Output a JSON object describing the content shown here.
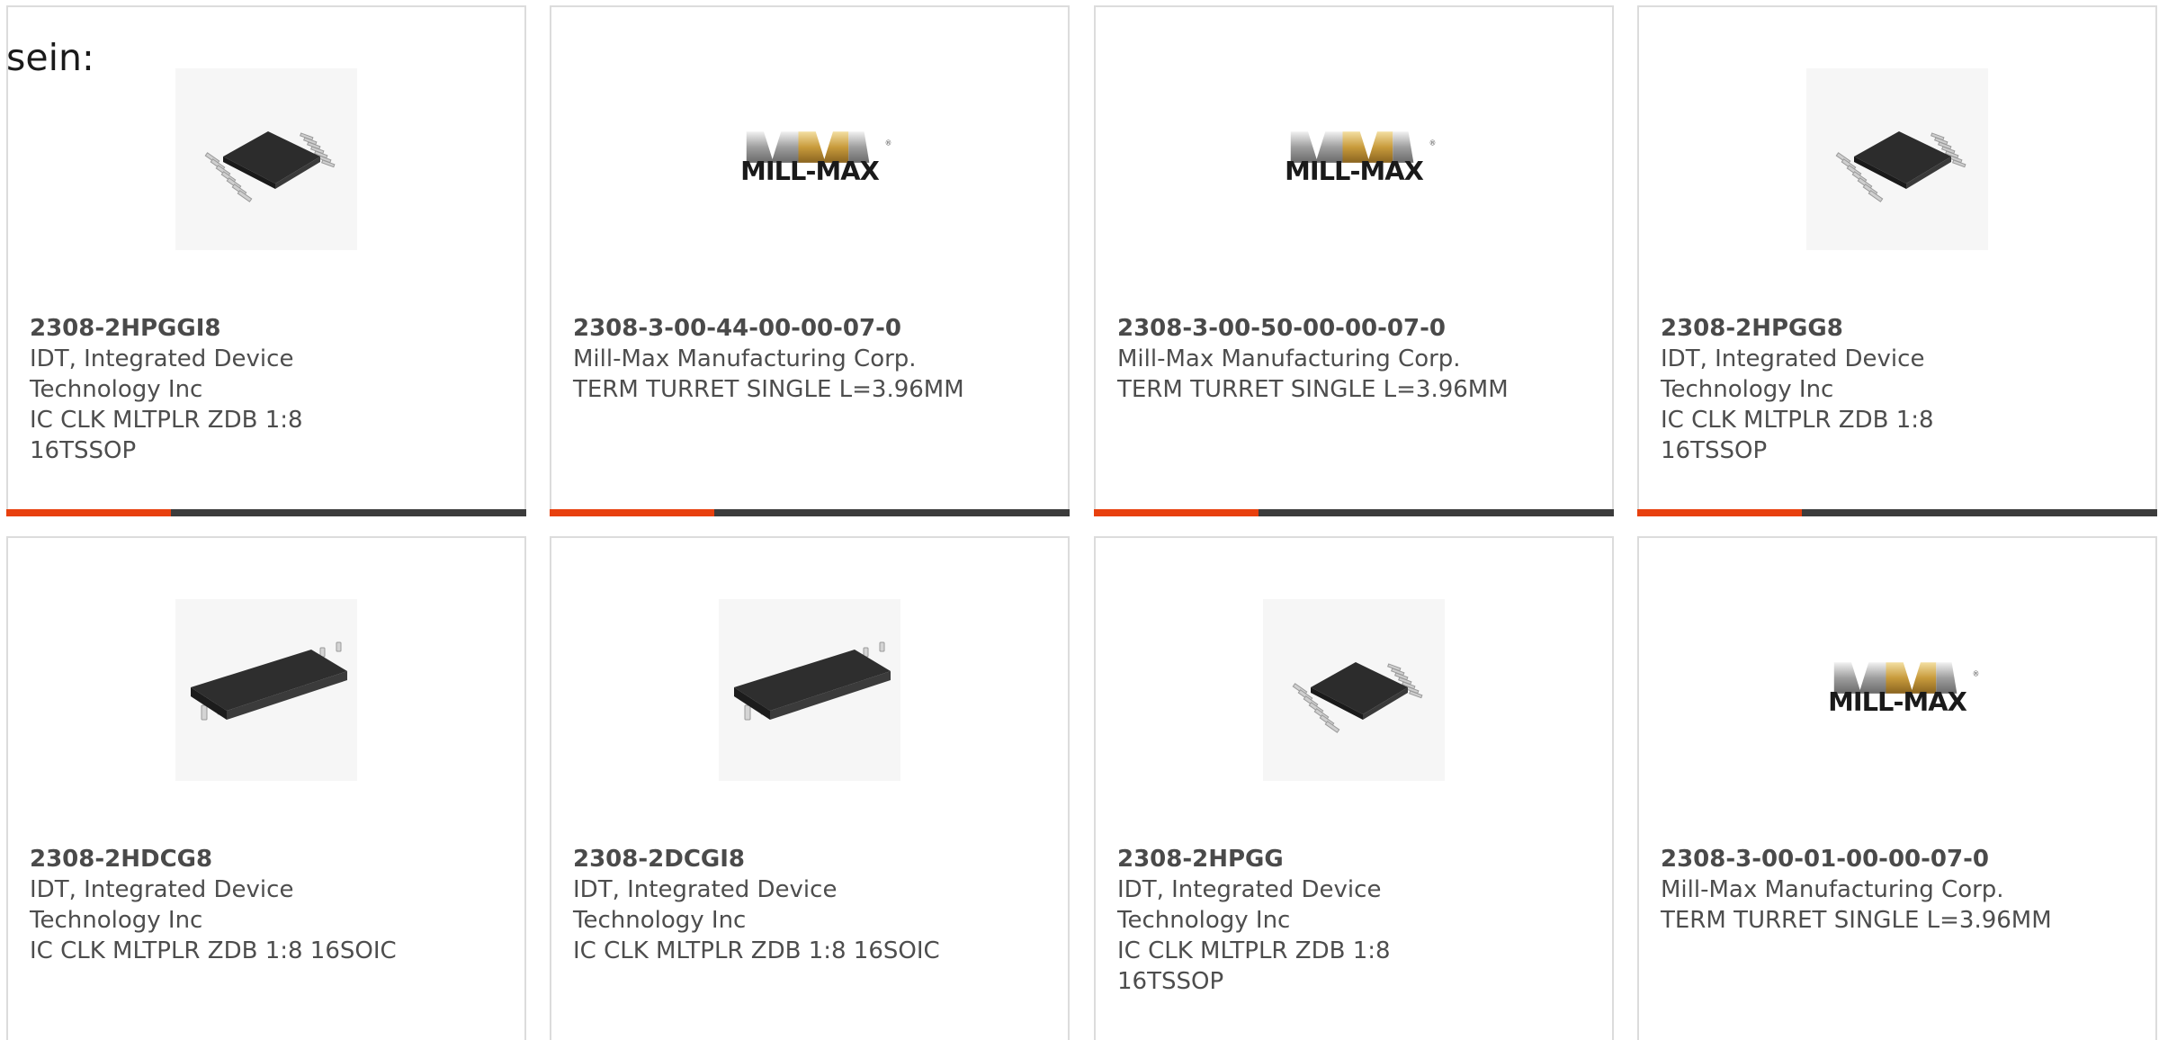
{
  "intro_text": "sein:",
  "colors": {
    "accent": "#e8400e",
    "bar": "#3c3c3c",
    "border": "#dcdcdc",
    "text": "#4d4d4d"
  },
  "products": [
    {
      "part_number": "2308-2HPGGI8",
      "manufacturer": "IDT, Integrated Device\nTechnology Inc",
      "description": "IC CLK MLTPLR ZDB 1:8\n16TSSOP",
      "image": "tssop-chip-image"
    },
    {
      "part_number": "2308-3-00-44-00-00-07-0",
      "manufacturer": "Mill-Max Manufacturing Corp.",
      "description": "TERM TURRET SINGLE L=3.96MM",
      "image": "mill-max-logo",
      "logo_text": "MILL-MAX"
    },
    {
      "part_number": "2308-3-00-50-00-00-07-0",
      "manufacturer": "Mill-Max Manufacturing Corp.",
      "description": "TERM TURRET SINGLE L=3.96MM",
      "image": "mill-max-logo",
      "logo_text": "MILL-MAX"
    },
    {
      "part_number": "2308-2HPGG8",
      "manufacturer": "IDT, Integrated Device\nTechnology Inc",
      "description": "IC CLK MLTPLR ZDB 1:8\n16TSSOP",
      "image": "tssop-chip-image"
    },
    {
      "part_number": "2308-2HDCG8",
      "manufacturer": "IDT, Integrated Device\nTechnology Inc",
      "description": "IC CLK MLTPLR ZDB 1:8 16SOIC",
      "image": "soic-chip-image"
    },
    {
      "part_number": "2308-2DCGI8",
      "manufacturer": "IDT, Integrated Device\nTechnology Inc",
      "description": "IC CLK MLTPLR ZDB 1:8 16SOIC",
      "image": "soic-chip-image"
    },
    {
      "part_number": "2308-2HPGG",
      "manufacturer": "IDT, Integrated Device\nTechnology Inc",
      "description": "IC CLK MLTPLR ZDB 1:8\n16TSSOP",
      "image": "tssop-chip-image"
    },
    {
      "part_number": "2308-3-00-01-00-00-07-0",
      "manufacturer": "Mill-Max Manufacturing Corp.",
      "description": "TERM TURRET SINGLE L=3.96MM",
      "image": "mill-max-logo",
      "logo_text": "MILL-MAX"
    }
  ]
}
